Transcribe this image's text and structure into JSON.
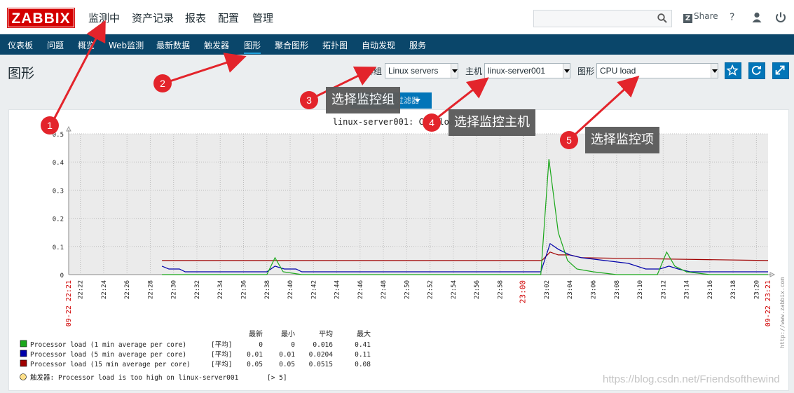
{
  "logo": "ZABBIX",
  "top_nav": [
    "监测中",
    "资产记录",
    "报表",
    "配置",
    "管理"
  ],
  "share_label": "Share",
  "help_label": "?",
  "sub_nav": [
    "仪表板",
    "问题",
    "概览",
    "Web监测",
    "最新数据",
    "触发器",
    "图形",
    "聚合图形",
    "拓扑图",
    "自动发现",
    "服务"
  ],
  "page_title": "图形",
  "filters": {
    "group_label": "群组",
    "group_value": "Linux servers",
    "host_label": "主机",
    "host_value": "linux-server001",
    "graph_label": "图形",
    "graph_value": "CPU load"
  },
  "filter_button": "过滤器",
  "graph_title": "linux-server001: CPU load",
  "side_credit": "http://www.zabbix.com",
  "legend": {
    "header": [
      "最新",
      "最小",
      "平均",
      "最大"
    ],
    "rows": [
      {
        "name": "Processor load (1 min average per core)",
        "func": "[平均]",
        "last": "0",
        "min": "0",
        "avg": "0.016",
        "max": "0.41",
        "color": "#1aa71a"
      },
      {
        "name": "Processor load (5 min average per core)",
        "func": "[平均]",
        "last": "0.01",
        "min": "0.01",
        "avg": "0.0204",
        "max": "0.11",
        "color": "#0000aa"
      },
      {
        "name": "Processor load (15 min average per core)",
        "func": "[平均]",
        "last": "0.05",
        "min": "0.05",
        "avg": "0.0515",
        "max": "0.08",
        "color": "#a00000"
      }
    ],
    "trigger": "触发器: Processor load is too high on linux-server001",
    "trigger_threshold": "[> 5]"
  },
  "chart_data": {
    "type": "line",
    "ylim": [
      0,
      0.5
    ],
    "y_ticks": [
      "0",
      "0.1",
      "0.2",
      "0.3",
      "0.4",
      "0.5"
    ],
    "x_start_label": "09-22 22:21",
    "x_end_label": "09-22 23:21",
    "x_ticks": [
      "22:22",
      "22:24",
      "22:26",
      "22:28",
      "22:30",
      "22:32",
      "22:34",
      "22:36",
      "22:38",
      "22:40",
      "22:42",
      "22:44",
      "22:46",
      "22:48",
      "22:50",
      "22:52",
      "22:54",
      "22:56",
      "22:58",
      "23:00",
      "23:02",
      "23:04",
      "23:06",
      "23:08",
      "23:10",
      "23:12",
      "23:14",
      "23:16",
      "23:18",
      "23:20"
    ],
    "x_range_minutes": [
      0,
      60
    ],
    "series": [
      {
        "name": "Processor load (1 min average per core)",
        "color": "#1aa71a",
        "points": [
          [
            8,
            0
          ],
          [
            10,
            0
          ],
          [
            12,
            0
          ],
          [
            14,
            0
          ],
          [
            16,
            0
          ],
          [
            17,
            0
          ],
          [
            17.7,
            0.06
          ],
          [
            18.4,
            0.01
          ],
          [
            20,
            0
          ],
          [
            26,
            0
          ],
          [
            30,
            0
          ],
          [
            40,
            0
          ],
          [
            40.5,
            0
          ],
          [
            41.2,
            0.41
          ],
          [
            42,
            0.15
          ],
          [
            42.8,
            0.05
          ],
          [
            43.6,
            0.02
          ],
          [
            45,
            0.01
          ],
          [
            47,
            0
          ],
          [
            49,
            0
          ],
          [
            50.5,
            0
          ],
          [
            51.3,
            0.08
          ],
          [
            52,
            0.03
          ],
          [
            53,
            0.01
          ],
          [
            55,
            0
          ],
          [
            60,
            0
          ]
        ]
      },
      {
        "name": "Processor load (5 min average per core)",
        "color": "#0000aa",
        "points": [
          [
            8,
            0.03
          ],
          [
            8.6,
            0.02
          ],
          [
            9.5,
            0.02
          ],
          [
            10,
            0.01
          ],
          [
            16,
            0.01
          ],
          [
            17,
            0.01
          ],
          [
            17.7,
            0.03
          ],
          [
            18.5,
            0.02
          ],
          [
            19.5,
            0.02
          ],
          [
            20,
            0.01
          ],
          [
            30,
            0.01
          ],
          [
            40,
            0.01
          ],
          [
            40.5,
            0.01
          ],
          [
            41.3,
            0.11
          ],
          [
            42,
            0.09
          ],
          [
            43,
            0.07
          ],
          [
            44,
            0.06
          ],
          [
            46,
            0.05
          ],
          [
            48,
            0.04
          ],
          [
            49.5,
            0.02
          ],
          [
            50.7,
            0.02
          ],
          [
            51.5,
            0.03
          ],
          [
            52.3,
            0.02
          ],
          [
            53.3,
            0.01
          ],
          [
            60,
            0.01
          ]
        ]
      },
      {
        "name": "Processor load (15 min average per core)",
        "color": "#a00000",
        "points": [
          [
            8,
            0.05
          ],
          [
            40.6,
            0.05
          ],
          [
            41.3,
            0.08
          ],
          [
            42,
            0.07
          ],
          [
            43,
            0.07
          ],
          [
            44,
            0.06
          ],
          [
            60,
            0.05
          ]
        ]
      }
    ]
  },
  "annotations": [
    {
      "n": "1"
    },
    {
      "n": "2"
    },
    {
      "n": "3",
      "text": "选择监控组"
    },
    {
      "n": "4",
      "text": "选择监控主机"
    },
    {
      "n": "5",
      "text": "选择监控项"
    }
  ],
  "watermark": "https://blog.csdn.net/Friendsofthewind"
}
